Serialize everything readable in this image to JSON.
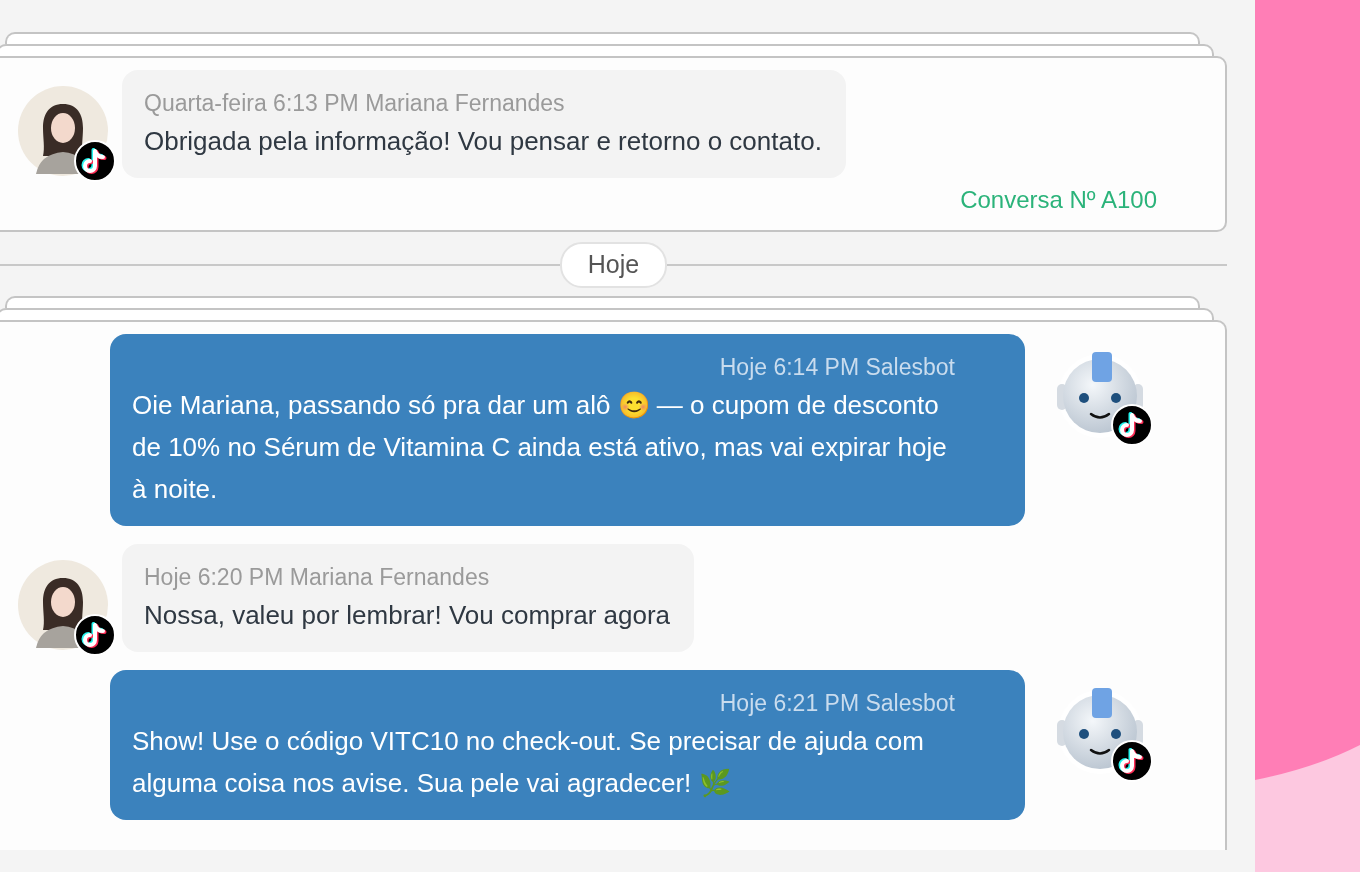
{
  "sections": [
    {
      "kind": "conversation",
      "messages": [
        {
          "kind": "incoming",
          "meta": "Quarta-feira 6:13 PM Mariana Fernandes",
          "text": "Obrigada pela informação! Vou pensar e retorno o contato."
        }
      ],
      "footer": "Conversa Nº A100"
    },
    {
      "kind": "date_divider",
      "label": "Hoje"
    },
    {
      "kind": "conversation",
      "messages": [
        {
          "kind": "outgoing",
          "meta": "Hoje 6:14 PM Salesbot",
          "text": "Oie Mariana, passando só pra dar um alô 😊 — o cupom de desconto de 10% no Sérum de Vitamina C ainda está ativo, mas vai expirar hoje à noite."
        },
        {
          "kind": "incoming",
          "meta": "Hoje 6:20 PM Mariana Fernandes",
          "text": "Nossa, valeu por lembrar! Vou comprar agora"
        },
        {
          "kind": "outgoing",
          "meta": "Hoje 6:21 PM Salesbot",
          "text": "Show! Use o código VITC10 no check-out. Se precisar de ajuda com alguma coisa nos avise. Sua pele vai agradecer! 🌿"
        }
      ]
    }
  ]
}
